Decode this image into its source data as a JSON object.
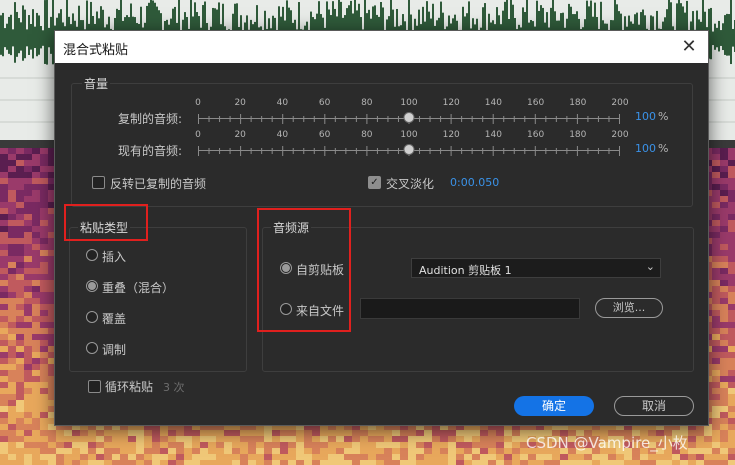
{
  "dialog": {
    "title": "混合式粘贴",
    "close_icon": "close-icon",
    "close_glyph": "✕"
  },
  "volume": {
    "title": "音量",
    "ticks": [
      "0",
      "20",
      "40",
      "60",
      "80",
      "100",
      "120",
      "140",
      "160",
      "180",
      "200"
    ],
    "copied": {
      "label": "复制的音频:",
      "value": 100,
      "value_text": "100",
      "unit": "%"
    },
    "existing": {
      "label": "现有的音频:",
      "value": 100,
      "value_text": "100",
      "unit": "%"
    },
    "invert_label": "反转已复制的音频",
    "invert_checked": false,
    "crossfade_label": "交叉淡化",
    "crossfade_checked": true,
    "crossfade_time": "0:00.050"
  },
  "paste_type": {
    "title": "粘贴类型",
    "options": [
      {
        "label": "插入",
        "checked": false
      },
      {
        "label": "重叠（混合）",
        "checked": true
      },
      {
        "label": "覆盖",
        "checked": false
      },
      {
        "label": "调制",
        "checked": false
      }
    ]
  },
  "audio_source": {
    "title": "音频源",
    "from_clipboard_label": "自剪贴板",
    "from_clipboard_checked": true,
    "clipboard_selected": "Audition 剪贴板 1",
    "from_file_label": "来自文件",
    "from_file_checked": false,
    "file_path": "",
    "browse_label": "浏览..."
  },
  "loop": {
    "label": "循环粘贴",
    "checked": false,
    "count": "3 次"
  },
  "buttons": {
    "ok": "确定",
    "cancel": "取消"
  },
  "watermark": "CSDN @Vampire_小枚",
  "colors": {
    "accent_blue": "#1473e6",
    "value_blue": "#3a92e8",
    "highlight_red": "#e0201e",
    "dialog_bg": "#2b2b2b"
  }
}
